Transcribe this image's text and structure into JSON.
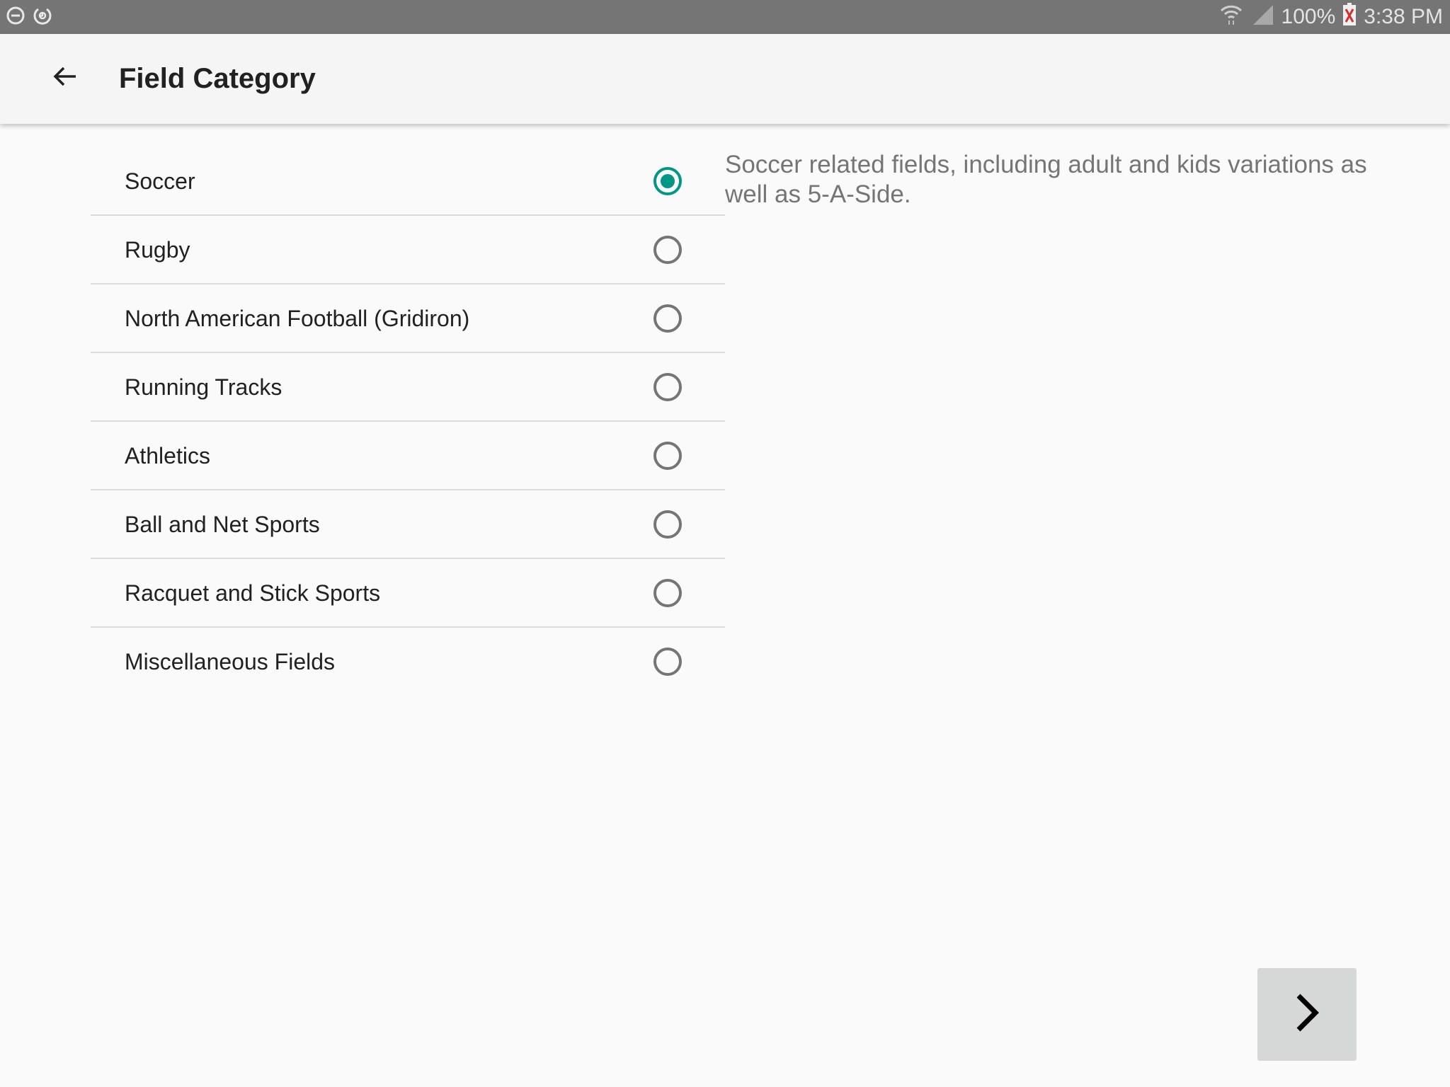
{
  "status_bar": {
    "left_icons": [
      "do-not-disturb-icon",
      "sync-icon"
    ],
    "wifi_icon": "wifi-icon",
    "signal_icon": "cellular-signal-icon",
    "battery_percent": "100%",
    "battery_icon": "battery-charging-error-icon",
    "time": "3:38 PM"
  },
  "toolbar": {
    "back_icon": "arrow-back-icon",
    "title": "Field Category"
  },
  "categories": [
    {
      "label": "Soccer",
      "selected": true
    },
    {
      "label": "Rugby",
      "selected": false
    },
    {
      "label": "North American Football (Gridiron)",
      "selected": false
    },
    {
      "label": "Running Tracks",
      "selected": false
    },
    {
      "label": "Athletics",
      "selected": false
    },
    {
      "label": "Ball and Net Sports",
      "selected": false
    },
    {
      "label": "Racquet and Stick Sports",
      "selected": false
    },
    {
      "label": "Miscellaneous Fields",
      "selected": false
    }
  ],
  "description": "Soccer related fields, including adult and kids variations as well as 5-A-Side.",
  "next_button": {
    "icon": "chevron-right-icon"
  },
  "colors": {
    "accent": "#009688",
    "status_bar": "#757575",
    "toolbar": "#f5f5f5",
    "background": "#fafafa",
    "next_button": "#d6d7d7"
  }
}
